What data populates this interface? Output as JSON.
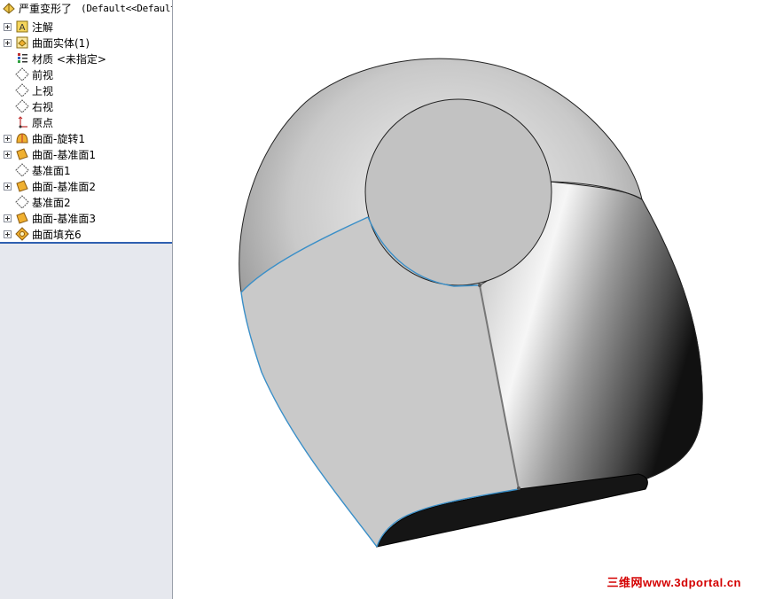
{
  "tree": {
    "root": {
      "label": "严重变形了",
      "config": "(Default<<Default",
      "icon": "part-icon"
    },
    "items": [
      {
        "label": "注解",
        "icon": "annotations-icon",
        "expandable": true
      },
      {
        "label": "曲面实体(1)",
        "icon": "surface-bodies-icon",
        "expandable": true
      },
      {
        "label": "材质 <未指定>",
        "icon": "material-icon",
        "expandable": false
      },
      {
        "label": "前视",
        "icon": "plane-icon",
        "expandable": false
      },
      {
        "label": "上视",
        "icon": "plane-icon",
        "expandable": false
      },
      {
        "label": "右视",
        "icon": "plane-icon",
        "expandable": false
      },
      {
        "label": "原点",
        "icon": "origin-icon",
        "expandable": false
      },
      {
        "label": "曲面-旋转1",
        "icon": "surface-revolve-icon",
        "expandable": true
      },
      {
        "label": "曲面-基准面1",
        "icon": "planar-surface-icon",
        "expandable": true
      },
      {
        "label": "基准面1",
        "icon": "plane-icon",
        "expandable": false
      },
      {
        "label": "曲面-基准面2",
        "icon": "planar-surface-icon",
        "expandable": true
      },
      {
        "label": "基准面2",
        "icon": "plane-icon",
        "expandable": false
      },
      {
        "label": "曲面-基准面3",
        "icon": "planar-surface-icon",
        "expandable": true
      },
      {
        "label": "曲面填充6",
        "icon": "fill-surface-icon",
        "expandable": true
      }
    ]
  },
  "watermark": "三维网www.3dportal.cn",
  "colors": {
    "tree_background": "#e6e8ee",
    "separator": "#2f5fb0",
    "selected_edge": "#3a8fc8",
    "watermark": "#d40000"
  }
}
